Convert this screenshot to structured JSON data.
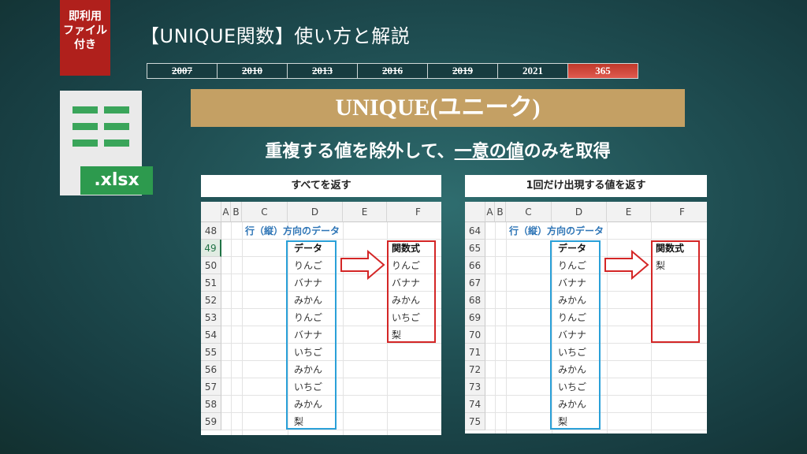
{
  "badge": {
    "lines": [
      "即利用",
      "ファイル",
      "付き"
    ]
  },
  "title": "【UNIQUE関数】使い方と解説",
  "versions": [
    {
      "label": "2007",
      "struck": true
    },
    {
      "label": "2010",
      "struck": true
    },
    {
      "label": "2013",
      "struck": true
    },
    {
      "label": "2016",
      "struck": true
    },
    {
      "label": "2019",
      "struck": true
    },
    {
      "label": "2021",
      "struck": false
    },
    {
      "label": "365",
      "struck": false,
      "current": true
    }
  ],
  "file_icon": {
    "icon": "excel-file-icon",
    "extension": ".xlsx"
  },
  "banner": "UNIQUE(ユニーク)",
  "subtitle": {
    "before": "重複する値を除外して、",
    "underlined": "一意の値",
    "after": "のみを取得"
  },
  "columns": [
    "A",
    "B",
    "C",
    "D",
    "E",
    "F"
  ],
  "colors": {
    "accent_red": "#d42626",
    "accent_blue": "#2aa0d8",
    "banner_gold": "#c4a064",
    "badge_red": "#b0201c"
  },
  "panels": [
    {
      "caption": "すべてを返す",
      "section_title": "行（縦）方向のデータ",
      "rows": [
        "48",
        "49",
        "50",
        "51",
        "52",
        "53",
        "54",
        "55",
        "56",
        "57",
        "58",
        "59"
      ],
      "data_header": "データ",
      "data": [
        "りんご",
        "バナナ",
        "みかん",
        "りんご",
        "バナナ",
        "いちご",
        "みかん",
        "いちご",
        "みかん",
        "梨"
      ],
      "result_header": "関数式",
      "result": [
        "りんご",
        "バナナ",
        "みかん",
        "いちご",
        "梨"
      ]
    },
    {
      "caption": "1回だけ出現する値を返す",
      "section_title": "行（縦）方向のデータ",
      "rows": [
        "64",
        "65",
        "66",
        "67",
        "68",
        "69",
        "70",
        "71",
        "72",
        "73",
        "74",
        "75"
      ],
      "data_header": "データ",
      "data": [
        "りんご",
        "バナナ",
        "みかん",
        "りんご",
        "バナナ",
        "いちご",
        "みかん",
        "いちご",
        "みかん",
        "梨"
      ],
      "result_header": "関数式",
      "result": [
        "梨"
      ]
    }
  ]
}
